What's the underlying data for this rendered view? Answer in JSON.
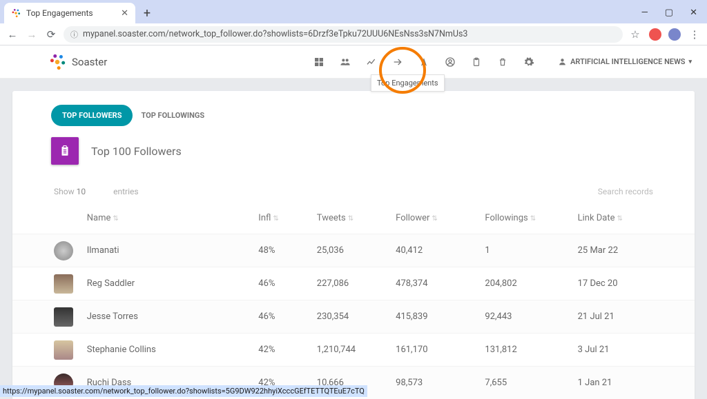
{
  "browser": {
    "tab_title": "Top Engagements",
    "url": "mypanel.soaster.com/network_top_follower.do?showlists=6Drzf3eTpku72UUU6NEsNss3sN7NmUs3",
    "status_link": "https://mypanel.soaster.com/network_top_follower.do?showlists=5G9DW922hhyiXcccGEfTETTQTEuE7cTQ"
  },
  "brand": "Soaster",
  "account_label": "ARTIFICIAL INTELLIGENCE NEWS",
  "tooltip": "Top Engagements",
  "tabs": {
    "active": "TOP FOLLOWERS",
    "inactive": "TOP FOLLOWINGS"
  },
  "section_title": "Top 100 Followers",
  "controls": {
    "show": "Show",
    "page_size": "10",
    "entries": "entries",
    "search_placeholder": "Search records"
  },
  "columns": {
    "name": "Name",
    "infl": "Infl",
    "tweets": "Tweets",
    "follower": "Follower",
    "followings": "Followings",
    "link_date": "Link Date"
  },
  "rows": [
    {
      "name": "Ilmanati",
      "infl": "48%",
      "tweets": "25,036",
      "follower": "40,412",
      "followings": "1",
      "link_date": "25 Mar 22"
    },
    {
      "name": "Reg Saddler",
      "infl": "46%",
      "tweets": "227,086",
      "follower": "478,374",
      "followings": "204,802",
      "link_date": "17 Dec 20"
    },
    {
      "name": "Jesse Torres",
      "infl": "46%",
      "tweets": "230,354",
      "follower": "415,839",
      "followings": "92,443",
      "link_date": "21 Jul 21"
    },
    {
      "name": "Stephanie Collins",
      "infl": "42%",
      "tweets": "1,210,744",
      "follower": "161,170",
      "followings": "131,812",
      "link_date": "3 Jul 21"
    },
    {
      "name": "Ruchi Dass",
      "infl": "42%",
      "tweets": "10,666",
      "follower": "98,573",
      "followings": "7,655",
      "link_date": "1 Jan 21"
    }
  ]
}
